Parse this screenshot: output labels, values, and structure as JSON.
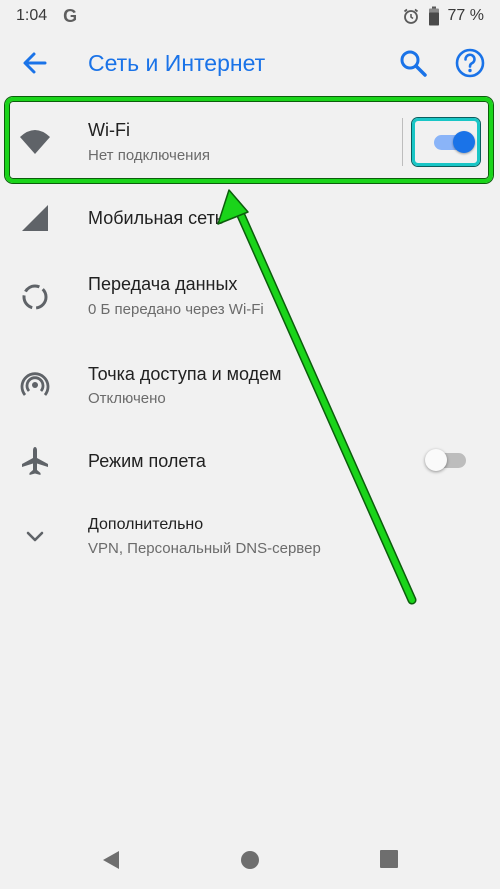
{
  "status_bar": {
    "time": "1:04",
    "g_letter": "G",
    "battery_pct": "77 %"
  },
  "app_bar": {
    "title": "Сеть и Интернет"
  },
  "rows": [
    {
      "title": "Wi-Fi",
      "subtitle": "Нет подключения",
      "icon": "wifi-icon",
      "toggle": "on"
    },
    {
      "title": "Мобильная сеть",
      "subtitle": "",
      "icon": "signal-icon"
    },
    {
      "title": "Передача данных",
      "subtitle": "0 Б передано через Wi-Fi",
      "icon": "data-usage-icon"
    },
    {
      "title": "Точка доступа и модем",
      "subtitle": "Отключено",
      "icon": "hotspot-icon"
    },
    {
      "title": "Режим полета",
      "subtitle": "",
      "icon": "airplane-icon",
      "toggle": "off"
    },
    {
      "title": "Дополнительно",
      "subtitle": "VPN, Персональный DNS-сервер",
      "icon": "chevron-down-icon"
    }
  ],
  "colors": {
    "accent": "#1a73e8",
    "highlight_green": "#1ad41a",
    "highlight_cyan": "#19c6c6",
    "background": "#f1f1f1"
  }
}
